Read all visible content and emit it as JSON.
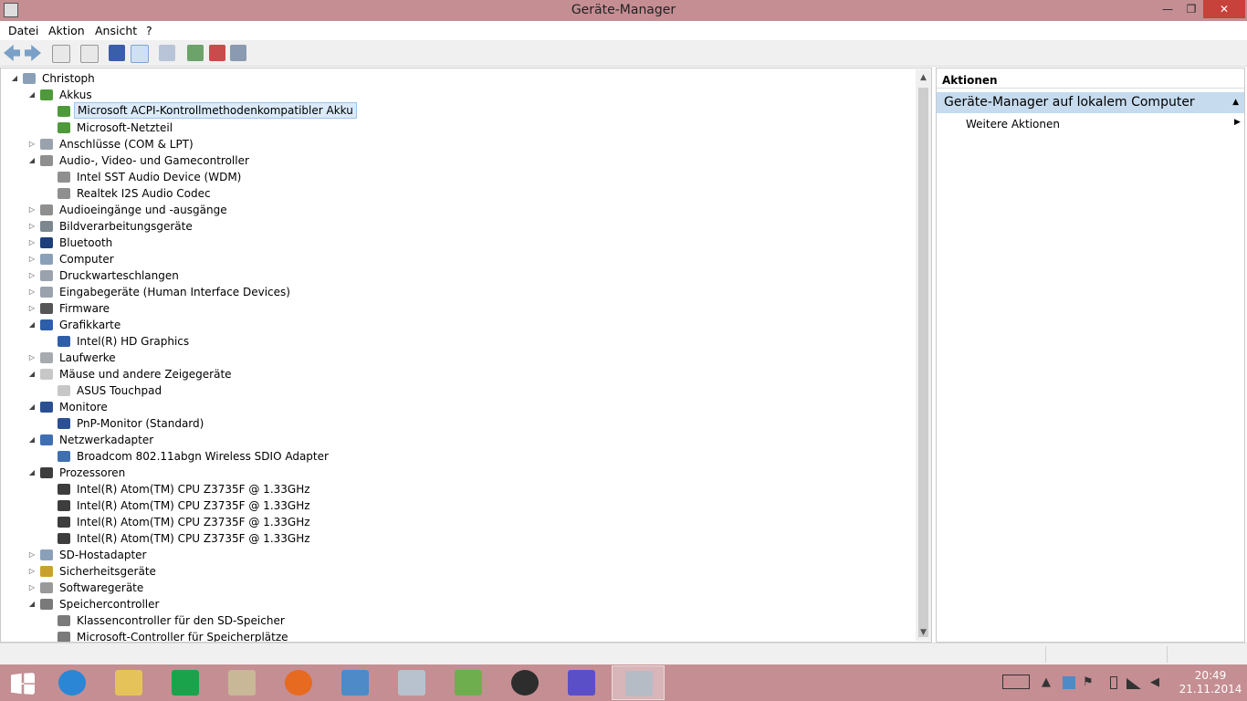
{
  "window": {
    "title": "Geräte-Manager",
    "minimize": "—",
    "maximize": "❐",
    "close": "✕"
  },
  "menu": [
    "Datei",
    "Aktion",
    "Ansicht",
    "?"
  ],
  "tree": [
    {
      "label": "Christoph",
      "level": 0,
      "exp": "▲",
      "icon": "computer-icon"
    },
    {
      "label": "Akkus",
      "level": 1,
      "exp": "▲",
      "icon": "battery-icon"
    },
    {
      "label": "Microsoft ACPI-Kontrollmethodenkompatibler Akku",
      "level": 2,
      "exp": "",
      "icon": "battery-icon",
      "selected": true
    },
    {
      "label": "Microsoft-Netzteil",
      "level": 2,
      "exp": "",
      "icon": "battery-icon"
    },
    {
      "label": "Anschlüsse (COM & LPT)",
      "level": 1,
      "exp": "▷",
      "icon": "port-icon"
    },
    {
      "label": "Audio-, Video- und Gamecontroller",
      "level": 1,
      "exp": "▲",
      "icon": "speaker-icon"
    },
    {
      "label": "Intel SST Audio Device (WDM)",
      "level": 2,
      "exp": "",
      "icon": "speaker-icon"
    },
    {
      "label": "Realtek I2S Audio Codec",
      "level": 2,
      "exp": "",
      "icon": "speaker-icon"
    },
    {
      "label": "Audioeingänge und -ausgänge",
      "level": 1,
      "exp": "▷",
      "icon": "speaker-icon"
    },
    {
      "label": "Bildverarbeitungsgeräte",
      "level": 1,
      "exp": "▷",
      "icon": "camera-icon"
    },
    {
      "label": "Bluetooth",
      "level": 1,
      "exp": "▷",
      "icon": "bluetooth-icon"
    },
    {
      "label": "Computer",
      "level": 1,
      "exp": "▷",
      "icon": "computer-icon"
    },
    {
      "label": "Druckwarteschlangen",
      "level": 1,
      "exp": "▷",
      "icon": "printer-icon"
    },
    {
      "label": "Eingabegeräte (Human Interface Devices)",
      "level": 1,
      "exp": "▷",
      "icon": "hid-icon"
    },
    {
      "label": "Firmware",
      "level": 1,
      "exp": "▷",
      "icon": "firmware-icon"
    },
    {
      "label": "Grafikkarte",
      "level": 1,
      "exp": "▲",
      "icon": "display-adapter-icon"
    },
    {
      "label": "Intel(R) HD Graphics",
      "level": 2,
      "exp": "",
      "icon": "display-adapter-icon"
    },
    {
      "label": "Laufwerke",
      "level": 1,
      "exp": "▷",
      "icon": "drive-icon"
    },
    {
      "label": "Mäuse und andere Zeigegeräte",
      "level": 1,
      "exp": "▲",
      "icon": "mouse-icon"
    },
    {
      "label": "ASUS Touchpad",
      "level": 2,
      "exp": "",
      "icon": "mouse-icon"
    },
    {
      "label": "Monitore",
      "level": 1,
      "exp": "▲",
      "icon": "monitor-icon"
    },
    {
      "label": "PnP-Monitor (Standard)",
      "level": 2,
      "exp": "",
      "icon": "monitor-icon"
    },
    {
      "label": "Netzwerkadapter",
      "level": 1,
      "exp": "▲",
      "icon": "network-icon"
    },
    {
      "label": "Broadcom 802.11abgn Wireless SDIO Adapter",
      "level": 2,
      "exp": "",
      "icon": "network-icon"
    },
    {
      "label": "Prozessoren",
      "level": 1,
      "exp": "▲",
      "icon": "cpu-icon"
    },
    {
      "label": "Intel(R) Atom(TM) CPU  Z3735F @ 1.33GHz",
      "level": 2,
      "exp": "",
      "icon": "cpu-icon"
    },
    {
      "label": "Intel(R) Atom(TM) CPU  Z3735F @ 1.33GHz",
      "level": 2,
      "exp": "",
      "icon": "cpu-icon"
    },
    {
      "label": "Intel(R) Atom(TM) CPU  Z3735F @ 1.33GHz",
      "level": 2,
      "exp": "",
      "icon": "cpu-icon"
    },
    {
      "label": "Intel(R) Atom(TM) CPU  Z3735F @ 1.33GHz",
      "level": 2,
      "exp": "",
      "icon": "cpu-icon"
    },
    {
      "label": "SD-Hostadapter",
      "level": 1,
      "exp": "▷",
      "icon": "sd-icon"
    },
    {
      "label": "Sicherheitsgeräte",
      "level": 1,
      "exp": "▷",
      "icon": "security-icon"
    },
    {
      "label": "Softwaregeräte",
      "level": 1,
      "exp": "▷",
      "icon": "software-device-icon"
    },
    {
      "label": "Speichercontroller",
      "level": 1,
      "exp": "▲",
      "icon": "storage-controller-icon"
    },
    {
      "label": "Klassencontroller für den SD-Speicher",
      "level": 2,
      "exp": "",
      "icon": "storage-controller-icon"
    },
    {
      "label": "Microsoft-Controller für Speicherplätze",
      "level": 2,
      "exp": "",
      "icon": "storage-controller-icon"
    }
  ],
  "actions": {
    "header": "Aktionen",
    "section": "Geräte-Manager auf lokalem Computer",
    "more": "Weitere Aktionen"
  },
  "taskbar": {
    "time": "20:49",
    "date": "21.11.2014"
  },
  "colors": {
    "accent": "#c48e93",
    "selection": "#dbeaf9",
    "section": "#c6dbee"
  }
}
